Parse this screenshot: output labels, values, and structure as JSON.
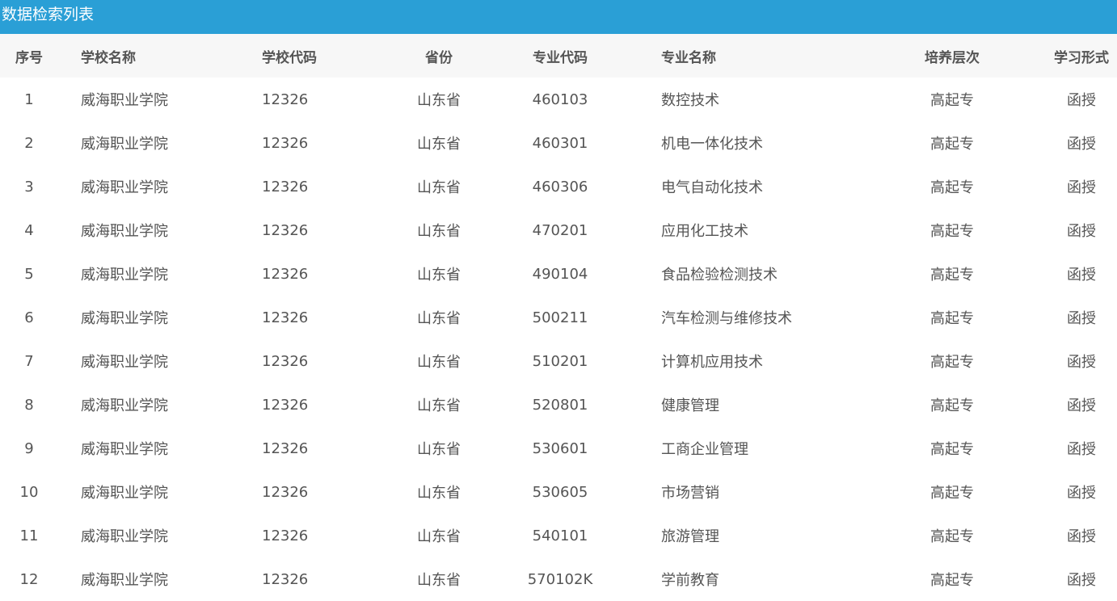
{
  "page_title": "数据检索列表",
  "columns": {
    "seq": "序号",
    "school_name": "学校名称",
    "school_code": "学校代码",
    "province": "省份",
    "major_code": "专业代码",
    "major_name": "专业名称",
    "level": "培养层次",
    "study_form": "学习形式"
  },
  "rows": [
    {
      "seq": "1",
      "school_name": "威海职业学院",
      "school_code": "12326",
      "province": "山东省",
      "major_code": "460103",
      "major_name": "数控技术",
      "level": "高起专",
      "study_form": "函授"
    },
    {
      "seq": "2",
      "school_name": "威海职业学院",
      "school_code": "12326",
      "province": "山东省",
      "major_code": "460301",
      "major_name": "机电一体化技术",
      "level": "高起专",
      "study_form": "函授"
    },
    {
      "seq": "3",
      "school_name": "威海职业学院",
      "school_code": "12326",
      "province": "山东省",
      "major_code": "460306",
      "major_name": "电气自动化技术",
      "level": "高起专",
      "study_form": "函授"
    },
    {
      "seq": "4",
      "school_name": "威海职业学院",
      "school_code": "12326",
      "province": "山东省",
      "major_code": "470201",
      "major_name": "应用化工技术",
      "level": "高起专",
      "study_form": "函授"
    },
    {
      "seq": "5",
      "school_name": "威海职业学院",
      "school_code": "12326",
      "province": "山东省",
      "major_code": "490104",
      "major_name": "食品检验检测技术",
      "level": "高起专",
      "study_form": "函授"
    },
    {
      "seq": "6",
      "school_name": "威海职业学院",
      "school_code": "12326",
      "province": "山东省",
      "major_code": "500211",
      "major_name": "汽车检测与维修技术",
      "level": "高起专",
      "study_form": "函授"
    },
    {
      "seq": "7",
      "school_name": "威海职业学院",
      "school_code": "12326",
      "province": "山东省",
      "major_code": "510201",
      "major_name": "计算机应用技术",
      "level": "高起专",
      "study_form": "函授"
    },
    {
      "seq": "8",
      "school_name": "威海职业学院",
      "school_code": "12326",
      "province": "山东省",
      "major_code": "520801",
      "major_name": "健康管理",
      "level": "高起专",
      "study_form": "函授"
    },
    {
      "seq": "9",
      "school_name": "威海职业学院",
      "school_code": "12326",
      "province": "山东省",
      "major_code": "530601",
      "major_name": "工商企业管理",
      "level": "高起专",
      "study_form": "函授"
    },
    {
      "seq": "10",
      "school_name": "威海职业学院",
      "school_code": "12326",
      "province": "山东省",
      "major_code": "530605",
      "major_name": "市场营销",
      "level": "高起专",
      "study_form": "函授"
    },
    {
      "seq": "11",
      "school_name": "威海职业学院",
      "school_code": "12326",
      "province": "山东省",
      "major_code": "540101",
      "major_name": "旅游管理",
      "level": "高起专",
      "study_form": "函授"
    },
    {
      "seq": "12",
      "school_name": "威海职业学院",
      "school_code": "12326",
      "province": "山东省",
      "major_code": "570102K",
      "major_name": "学前教育",
      "level": "高起专",
      "study_form": "函授"
    }
  ],
  "colors": {
    "title_bar": "#2a9fd6",
    "header_row": "#f7f7f7",
    "text": "#555555"
  }
}
